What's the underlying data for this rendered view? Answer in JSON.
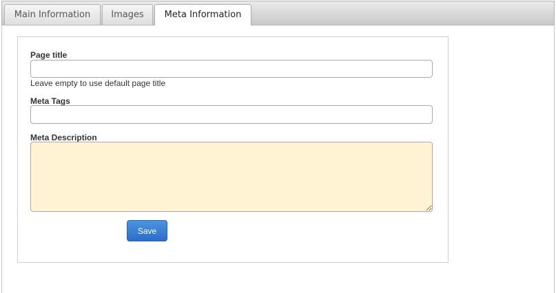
{
  "tabs": [
    {
      "label": "Main Information",
      "active": false
    },
    {
      "label": "Images",
      "active": false
    },
    {
      "label": "Meta Information",
      "active": true
    }
  ],
  "form": {
    "page_title": {
      "label": "Page title",
      "value": "",
      "hint": "Leave empty to use default page title"
    },
    "meta_tags": {
      "label": "Meta Tags",
      "value": ""
    },
    "meta_description": {
      "label": "Meta Description",
      "value": ""
    },
    "save_label": "Save"
  },
  "colors": {
    "textarea_bg": "#fff3d3",
    "save_button": "#2a6ec8"
  }
}
